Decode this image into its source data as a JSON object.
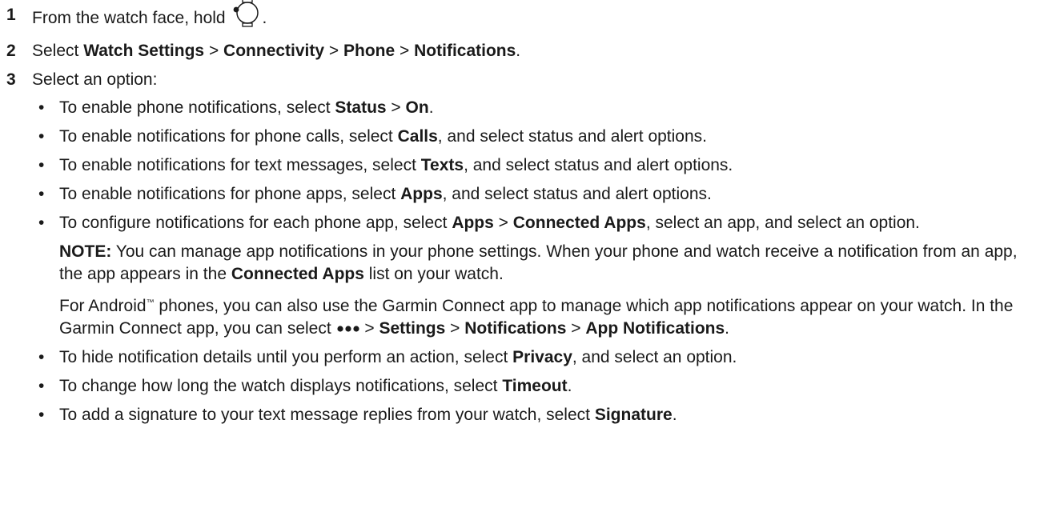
{
  "steps": [
    {
      "num": "1",
      "text": "From the watch face, hold ",
      "after": ".",
      "icon": "watch-button-icon"
    },
    {
      "num": "2",
      "pre": "Select ",
      "b1": "Watch Settings",
      "s1": " > ",
      "b2": "Connectivity",
      "s2": " > ",
      "b3": "Phone",
      "s3": " > ",
      "b4": "Notifications",
      "end": "."
    },
    {
      "num": "3",
      "text": "Select an option:"
    }
  ],
  "options": [
    {
      "pre": "To enable phone notifications, select ",
      "b1": "Status",
      "mid": " > ",
      "b2": "On",
      "end": "."
    },
    {
      "pre": "To enable notifications for phone calls, select ",
      "b1": "Calls",
      "end": ", and select status and alert options."
    },
    {
      "pre": "To enable notifications for text messages, select ",
      "b1": "Texts",
      "end": ", and select status and alert options."
    },
    {
      "pre": "To enable notifications for phone apps, select ",
      "b1": "Apps",
      "end": ", and select status and alert options."
    },
    {
      "pre": "To configure notifications for each phone app, select ",
      "b1": "Apps",
      "mid": " > ",
      "b2": "Connected Apps",
      "end": ", select an app, and select an option."
    },
    {
      "pre": "To hide notification details until you perform an action, select ",
      "b1": "Privacy",
      "end": ", and select an option."
    },
    {
      "pre": "To change how long the watch displays notifications, select ",
      "b1": "Timeout",
      "end": "."
    },
    {
      "pre": "To add a signature to your text message replies from your watch, select ",
      "b1": "Signature",
      "end": "."
    }
  ],
  "note": {
    "label": "NOTE:",
    "text1": " You can manage app notifications in your phone settings. When your phone and watch receive a notification from an app, the app appears in the ",
    "bold": "Connected Apps",
    "text2": " list on your watch."
  },
  "android": {
    "pre": "For Android",
    "tm": "™",
    "text1": " phones, you can also use the Garmin Connect app to manage which app notifications appear on your watch. In the Garmin Connect app, you can select ",
    "icon": "more-dots-icon",
    "sep1": " > ",
    "b1": "Settings",
    "sep2": " > ",
    "b2": "Notifications",
    "sep3": " > ",
    "b3": "App Notifications",
    "end": "."
  },
  "bullet_char": "•"
}
